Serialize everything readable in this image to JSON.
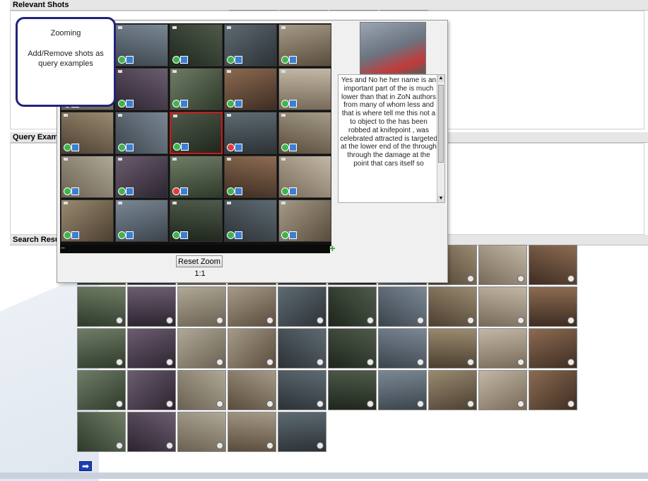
{
  "sections": {
    "relevant": "Relevant Shots",
    "query": "Query Examp",
    "search": "Search Resul"
  },
  "callout": {
    "line1": "Zooming",
    "line2": "Add/Remove shots as query examples"
  },
  "zoom": {
    "reset_label": "Reset Zoom",
    "level": "1:1",
    "selected_index": 12
  },
  "transcript": "Yes and No he her name is an important part of the is much lower than that in ZoN authors from many of whom less and that is where tell me this not a to object to the has been robbed at knifepoint , was celebrated attracted is targeted at the lower end of the through through the damage at the point that cars itself so",
  "colors": {
    "callout_border": "#22237a",
    "selected_border": "#d01818",
    "next_button": "#1b3fb6"
  },
  "icons": {
    "zoom_out": "minus-icon",
    "zoom_in": "plus-icon",
    "next": "right-arrow-icon"
  },
  "symbols": {
    "zoom_in": "+",
    "zoom_out": "−",
    "next": "➡",
    "scroll_up": "▲",
    "scroll_down": "▼"
  }
}
